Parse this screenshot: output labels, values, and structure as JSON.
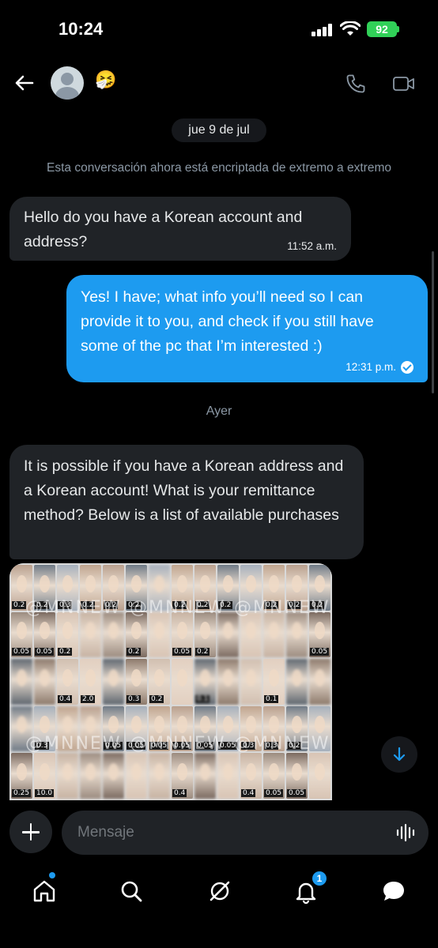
{
  "status_bar": {
    "time": "10:24",
    "battery": "92"
  },
  "header": {
    "emoji": "🤧",
    "icons": [
      "back-arrow-icon",
      "phone-icon",
      "video-icon"
    ]
  },
  "conversation": {
    "date_pill": "jue 9 de jul",
    "encryption_note": "Esta conversación ahora está encriptada de extremo a extremo",
    "messages": [
      {
        "direction": "in",
        "text": "Hello do you have a Korean account and address?",
        "time": "11:52 a.m."
      },
      {
        "direction": "out",
        "text": "Yes! I have; what info you’ll need so I can provide it to you, and check if you still have some of the pc that I’m interested :)",
        "time": "12:31 p.m."
      }
    ],
    "day_separator": "Ayer",
    "message3": {
      "direction": "in",
      "text": "It is possible if you have a Korean address and a Korean account! What is your remittance method? Below is a list of available purchases"
    },
    "photo": {
      "watermark": "@MNNEW",
      "labels": [
        [
          "0.2",
          "0.2",
          "0.3",
          "0.2",
          "0.2",
          "0.2",
          "",
          "0.2",
          "0.2",
          "0.2",
          "",
          "0.2",
          "0.2",
          "0.2"
        ],
        [
          "0.05",
          "0.05",
          "0.2",
          "",
          "",
          "0.2",
          "",
          "0.05",
          "0.2",
          "",
          "",
          "",
          "",
          "0.05"
        ],
        [
          "",
          "",
          "0.4",
          "2.0",
          "",
          "0.3",
          "0.2",
          "",
          "0.1",
          "",
          "",
          "0.1",
          "",
          ""
        ],
        [
          "",
          "0.3",
          "",
          "",
          "0.05",
          "0.05",
          "0.05",
          "0.05",
          "0.05",
          "0.05",
          "0.3",
          "0.3",
          "0.2",
          ""
        ],
        [
          "0.25",
          "10.0",
          "",
          "",
          "",
          "",
          "",
          "0.4",
          "",
          "",
          "0.4",
          "0.05",
          "0.05",
          ""
        ]
      ]
    }
  },
  "composer": {
    "placeholder": "Mensaje"
  },
  "tabbar": {
    "notification_count": "1"
  },
  "colors": {
    "accent": "#1d9bf0",
    "bubble_in": "#202327",
    "background": "#000000"
  }
}
